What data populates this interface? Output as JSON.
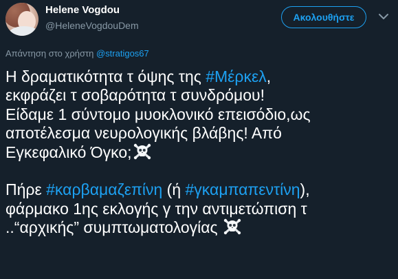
{
  "author": {
    "display_name": "Helene Vogdou",
    "handle": "@HeleneVogdouDem"
  },
  "follow_button_label": "Ακολουθήστε",
  "reply": {
    "prefix": "Απάντηση στο χρήστη",
    "mention": "@stratigos67"
  },
  "tweet": {
    "l1_a": "Η δραματικότητα τ όψης της ",
    "l1_tag": "#Μέρκελ",
    "l1_b": ",",
    "l2": "εκφράζει τ σοβαρότητα τ συνδρόμου!",
    "l3": "Είδαμε 1 σύντομο μυοκλονικό επεισόδιο,ως",
    "l4": "αποτέλεσμα νευρολογικής βλάβης! Από",
    "l5": "Εγκεφαλικό Όγκο;",
    "l6_a": "Πήρε ",
    "l6_tag1": "#καρβαμαζεπίνη",
    "l6_b": " (ή ",
    "l6_tag2": "#γκαμπαπεντίνη",
    "l6_c": "),",
    "l7": "φάρμακο 1ης εκλογής γ την αντιμετώπιση τ",
    "l8": "..“αρχικής” συμπτωματολογίας"
  },
  "icons": {
    "emoji": "skull-and-crossbones",
    "menu": "chevron-down"
  },
  "colors": {
    "background": "#15202b",
    "accent": "#1da1f2",
    "secondary_text": "#8899a6",
    "primary_text": "#ffffff"
  }
}
